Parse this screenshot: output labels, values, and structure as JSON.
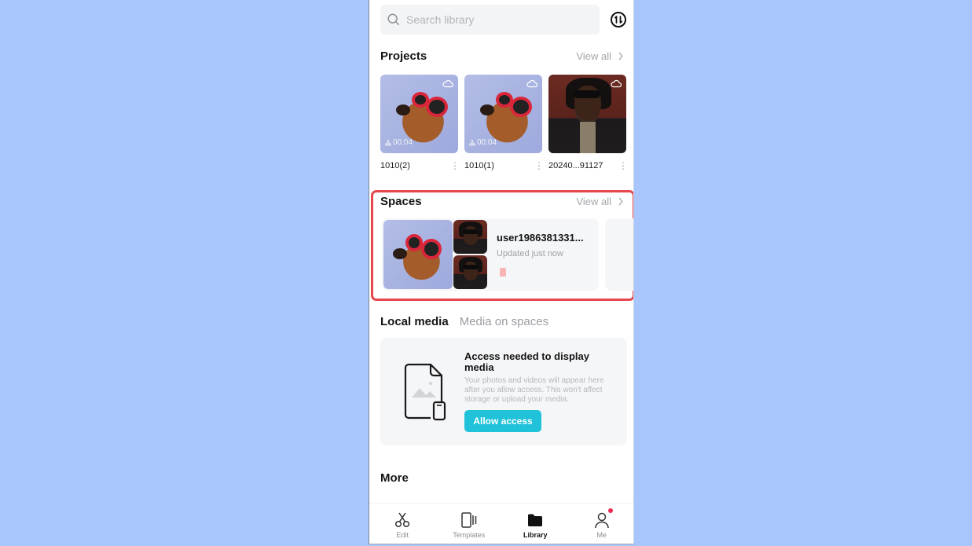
{
  "search": {
    "placeholder": "Search library"
  },
  "projects": {
    "title": "Projects",
    "view_all": "View all",
    "items": [
      {
        "name": "1010(2)",
        "duration": "00:04",
        "thumb": "dog"
      },
      {
        "name": "1010(1)",
        "duration": "00:04",
        "thumb": "dog"
      },
      {
        "name": "20240...91127",
        "duration": "",
        "thumb": "man"
      }
    ]
  },
  "spaces": {
    "title": "Spaces",
    "view_all": "View all",
    "card": {
      "name": "user1986381331...",
      "updated": "Updated just now"
    }
  },
  "media_tabs": {
    "local": "Local media",
    "spaces": "Media on spaces"
  },
  "access": {
    "title": "Access needed to display media",
    "description": "Your photos and videos will appear here after you allow access. This won't affect storage or upload your media.",
    "button": "Allow access"
  },
  "more": {
    "title": "More"
  },
  "nav": {
    "items": [
      {
        "label": "Edit",
        "icon": "scissors-icon"
      },
      {
        "label": "Templates",
        "icon": "templates-icon"
      },
      {
        "label": "Library",
        "icon": "folder-icon",
        "active": true
      },
      {
        "label": "Me",
        "icon": "person-icon",
        "badge": true
      }
    ]
  },
  "colors": {
    "accent": "#1fc2d8",
    "highlight": "#e5474d",
    "background": "#a9c6fc"
  }
}
